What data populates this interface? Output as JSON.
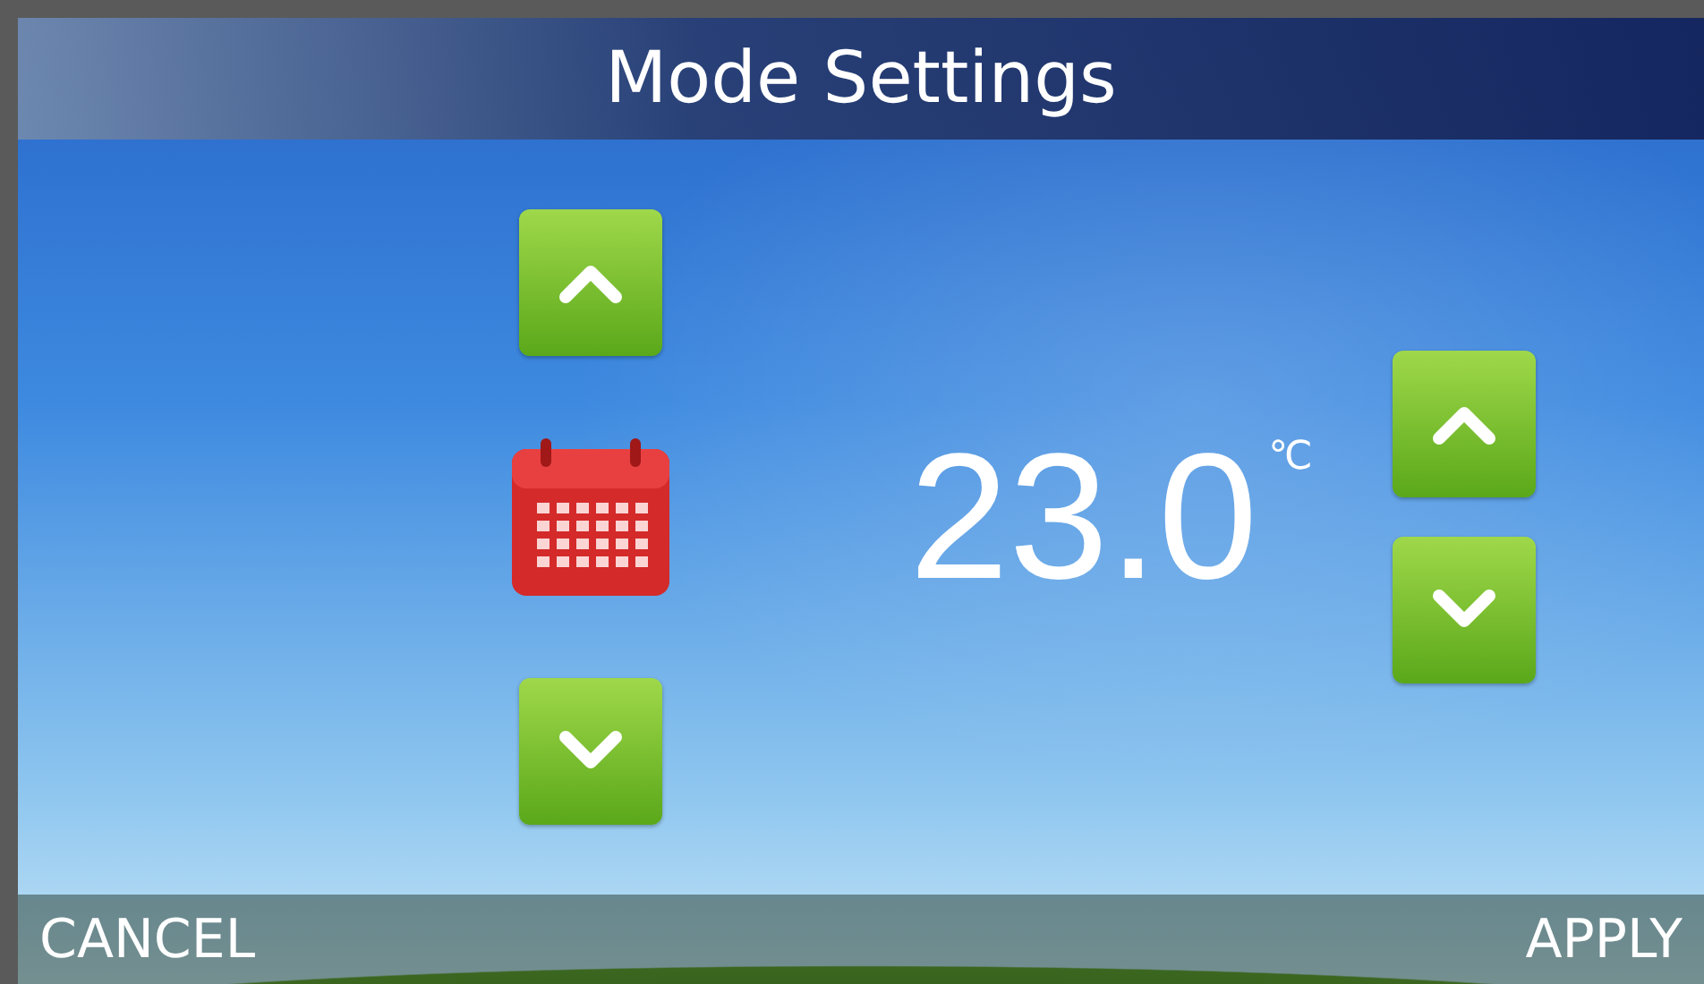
{
  "title": "Mode Settings",
  "mode": {
    "kind": "schedule"
  },
  "temperature": {
    "value": "23.0",
    "unit": "℃"
  },
  "buttons": [
    {
      "label": "CANCEL"
    },
    {
      "label": "APPLY"
    }
  ]
}
